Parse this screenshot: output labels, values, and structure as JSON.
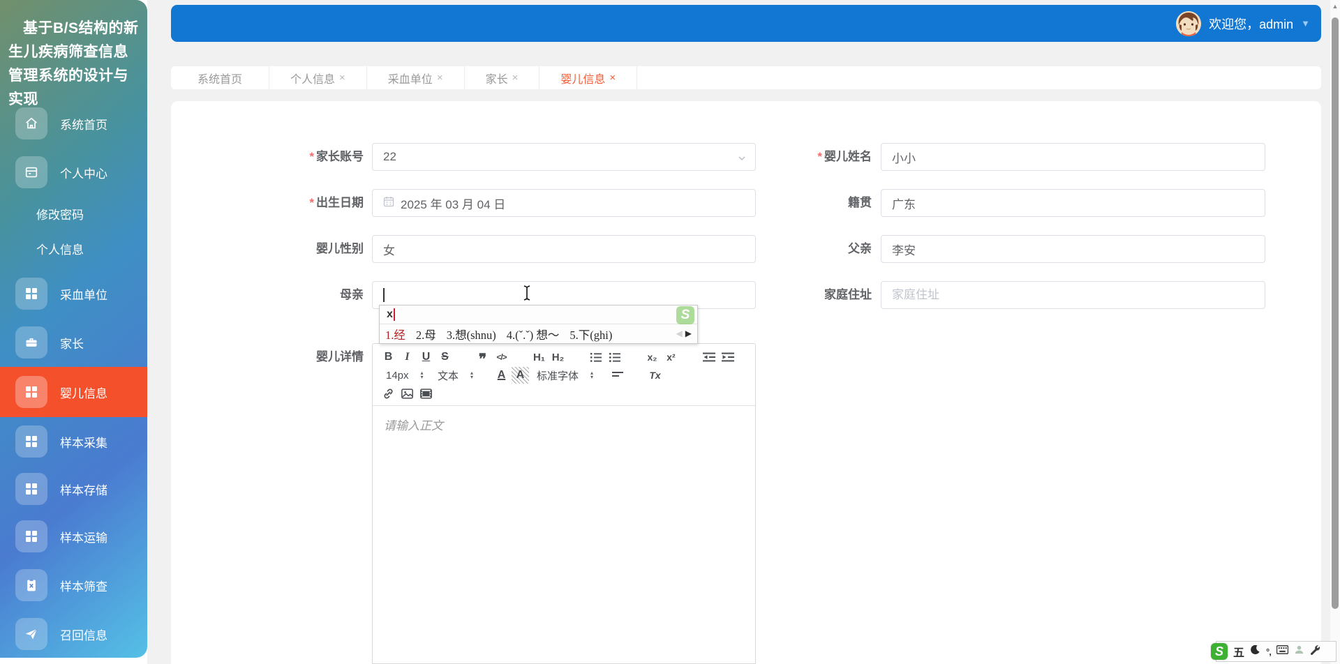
{
  "app": {
    "title": "基于B/S结构的新生儿疾病筛查信息管理系统的设计与实现"
  },
  "header": {
    "welcome": "欢迎您，admin"
  },
  "sidebar": {
    "items": [
      "系统首页",
      "个人中心",
      "修改密码",
      "个人信息",
      "采血单位",
      "家长",
      "婴儿信息",
      "样本采集",
      "样本存储",
      "样本运输",
      "样本筛查",
      "召回信息"
    ]
  },
  "tabs": {
    "labels": [
      "系统首页",
      "个人信息",
      "采血单位",
      "家长",
      "婴儿信息"
    ],
    "close": "×"
  },
  "form": {
    "parent_account_label": "家长账号",
    "parent_account_value": "22",
    "baby_name_label": "婴儿姓名",
    "baby_name_value": "小小",
    "birth_date_label": "出生日期",
    "birth_date_value": "2025 年 03 月 04 日",
    "native_label": "籍贯",
    "native_value": "广东",
    "gender_label": "婴儿性别",
    "gender_value": "女",
    "father_label": "父亲",
    "father_value": "李安",
    "mother_label": "母亲",
    "mother_value": "",
    "address_label": "家庭住址",
    "address_placeholder": "家庭住址",
    "detail_label": "婴儿详情"
  },
  "editor": {
    "placeholder": "请输入正文",
    "toolbar": {
      "bold": "B",
      "italic": "I",
      "underline": "U",
      "strike": "S",
      "quote": "❞",
      "code": "</>",
      "h1": "H₁",
      "h2": "H₂",
      "sub": "x₂",
      "sup": "x²",
      "size": "14px",
      "format": "文本",
      "font": "标准字体",
      "color": "A",
      "background": "A",
      "clear": "Tx"
    }
  },
  "ime": {
    "typed": "x",
    "candidates": [
      "1.经",
      "2.母",
      "3.想(shnu)",
      "4.(ˇ.ˇ) 想～",
      "5.下(ghi)"
    ],
    "prev": "◀",
    "next": "▶"
  },
  "ime_bar": {
    "logo": "S",
    "mode": "五",
    "punct": "°,"
  },
  "colors": {
    "header_blue": "#1277d3",
    "active_orange": "#f4502c",
    "required_red": "#f56c6c"
  }
}
